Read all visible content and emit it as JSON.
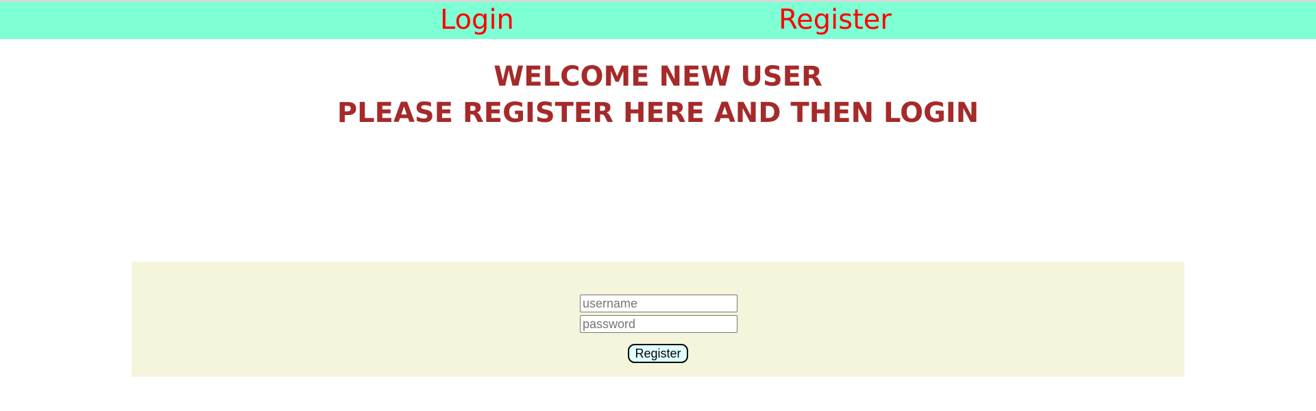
{
  "nav": {
    "login_label": "Login",
    "register_label": "Register"
  },
  "heading": {
    "line1": "WELCOME NEW USER",
    "line2": "PLEASE REGISTER HERE AND THEN LOGIN"
  },
  "form": {
    "username_placeholder": "username",
    "username_value": "",
    "password_placeholder": "password",
    "password_value": "",
    "submit_label": "Register"
  },
  "colors": {
    "navbar_background": "#7fffd4",
    "nav_link": "#ff0000",
    "heading_text": "#a52a2a",
    "form_background": "#f5f5dc",
    "button_background": "#e0ffff"
  }
}
